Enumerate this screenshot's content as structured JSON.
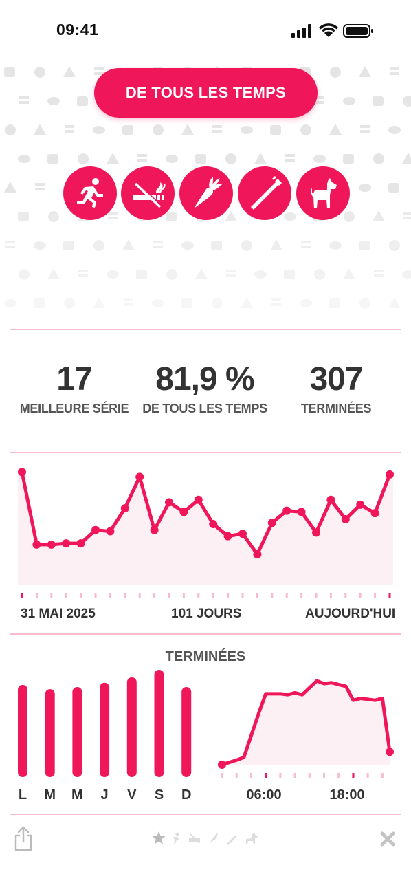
{
  "status_bar": {
    "time": "09:41"
  },
  "period_button": {
    "label": "DE TOUS LES TEMPS"
  },
  "habits": [
    {
      "name": "running",
      "icon": "running-icon"
    },
    {
      "name": "no-smoking",
      "icon": "no-smoking-icon"
    },
    {
      "name": "carrot",
      "icon": "carrot-icon"
    },
    {
      "name": "toothbrush",
      "icon": "toothbrush-icon"
    },
    {
      "name": "dog",
      "icon": "dog-icon"
    }
  ],
  "stats": {
    "best_streak": {
      "value": "17",
      "label": "MEILLEURE SÉRIE"
    },
    "rate": {
      "value": "81,9 %",
      "label": "DE TOUS LES TEMPS"
    },
    "completed": {
      "value": "307",
      "label": "TERMINÉES"
    }
  },
  "line_chart": {
    "start_label": "31 MAI 2025",
    "middle_label": "101 JOURS",
    "end_label": "AUJOURD'HUI"
  },
  "bar_chart": {
    "title": "TERMINÉES"
  },
  "hour_chart": {
    "labels": [
      "06:00",
      "18:00"
    ]
  },
  "colors": {
    "accent": "#f0165a",
    "light_fill": "#fdf0f4",
    "divider": "#f8bccd"
  },
  "toolbar": {
    "share_icon": "share-icon",
    "close_icon": "close-icon",
    "star_icon": "star-icon"
  },
  "chart_data": [
    {
      "type": "line",
      "values": [
        0.93,
        0.33,
        0.33,
        0.34,
        0.34,
        0.45,
        0.44,
        0.63,
        0.89,
        0.45,
        0.68,
        0.6,
        0.7,
        0.5,
        0.4,
        0.42,
        0.25,
        0.51,
        0.61,
        0.6,
        0.43,
        0.7,
        0.54,
        0.66,
        0.59,
        0.91
      ]
    },
    {
      "type": "bar",
      "categories": [
        "L",
        "M",
        "M",
        "J",
        "V",
        "S",
        "D"
      ],
      "values": [
        0.86,
        0.82,
        0.84,
        0.88,
        0.93,
        1.0,
        0.84
      ]
    },
    {
      "type": "area",
      "x": [
        0,
        2,
        3,
        5,
        6,
        8,
        9,
        10,
        11,
        13,
        14,
        15,
        17,
        18,
        19,
        21,
        22,
        23
      ],
      "values": [
        0.0,
        0.05,
        0.08,
        0.55,
        0.77,
        0.77,
        0.76,
        0.78,
        0.76,
        0.91,
        0.88,
        0.89,
        0.85,
        0.7,
        0.72,
        0.7,
        0.72,
        0.14
      ]
    }
  ]
}
